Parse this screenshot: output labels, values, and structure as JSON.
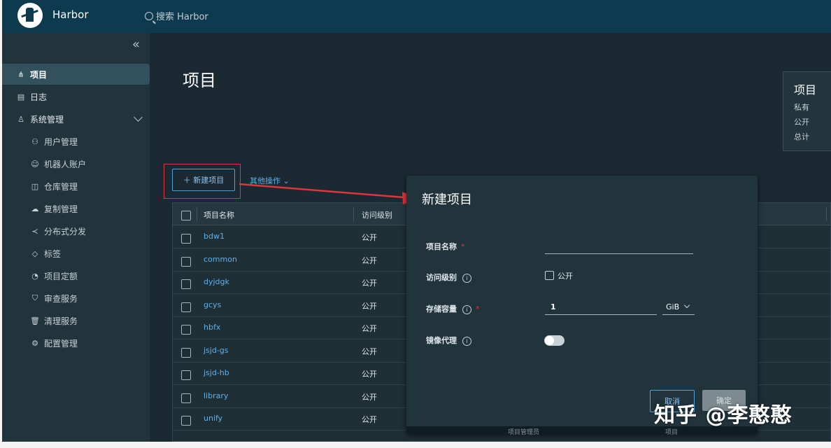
{
  "header": {
    "brand": "Harbor",
    "search_placeholder": "搜索 Harbor"
  },
  "sidebar": {
    "items": [
      {
        "label": "项目",
        "icon": "project-icon"
      },
      {
        "label": "日志",
        "icon": "log-icon"
      },
      {
        "label": "系统管理",
        "icon": "admin-icon"
      }
    ],
    "sub_items": [
      {
        "label": "用户管理",
        "icon": "users-icon"
      },
      {
        "label": "机器人账户",
        "icon": "robot-icon"
      },
      {
        "label": "仓库管理",
        "icon": "box-icon"
      },
      {
        "label": "复制管理",
        "icon": "cloud-icon"
      },
      {
        "label": "分布式分发",
        "icon": "share-icon"
      },
      {
        "label": "标签",
        "icon": "tag-icon"
      },
      {
        "label": "项目定额",
        "icon": "quota-icon"
      },
      {
        "label": "审查服务",
        "icon": "shield-icon"
      },
      {
        "label": "清理服务",
        "icon": "trash-icon"
      },
      {
        "label": "配置管理",
        "icon": "gear-icon"
      }
    ]
  },
  "main": {
    "title": "项目",
    "new_project_button": "新建项目",
    "other_ops": "其他操作",
    "summary": {
      "title": "项目",
      "labels": [
        "私有",
        "公开",
        "总计"
      ]
    },
    "table": {
      "headers": [
        "项目名称",
        "访问级别"
      ],
      "rows": [
        {
          "name": "bdw1",
          "access": "公开"
        },
        {
          "name": "common",
          "access": "公开"
        },
        {
          "name": "dyjdgk",
          "access": "公开"
        },
        {
          "name": "gcys",
          "access": "公开"
        },
        {
          "name": "hbfx",
          "access": "公开"
        },
        {
          "name": "jsjd-gs",
          "access": "公开"
        },
        {
          "name": "jsjd-hb",
          "access": "公开"
        },
        {
          "name": "library",
          "access": "公开"
        },
        {
          "name": "unify",
          "access": "公开"
        }
      ]
    }
  },
  "modal": {
    "title": "新建项目",
    "name_label": "项目名称",
    "access_label": "访问级别",
    "public_label": "公开",
    "storage_label": "存储容量",
    "storage_value": "1",
    "storage_unit": "GiB",
    "proxy_label": "镜像代理",
    "cancel": "取消",
    "confirm": "确定",
    "footer_left": "项目管理员",
    "footer_right": "项目"
  },
  "watermark": "知乎 @李憨憨",
  "colors": {
    "accent": "#4da3d9",
    "highlight": "#e0353d",
    "header": "#0e3a4f",
    "sidebar": "#21333b",
    "content": "#1b2a32"
  }
}
